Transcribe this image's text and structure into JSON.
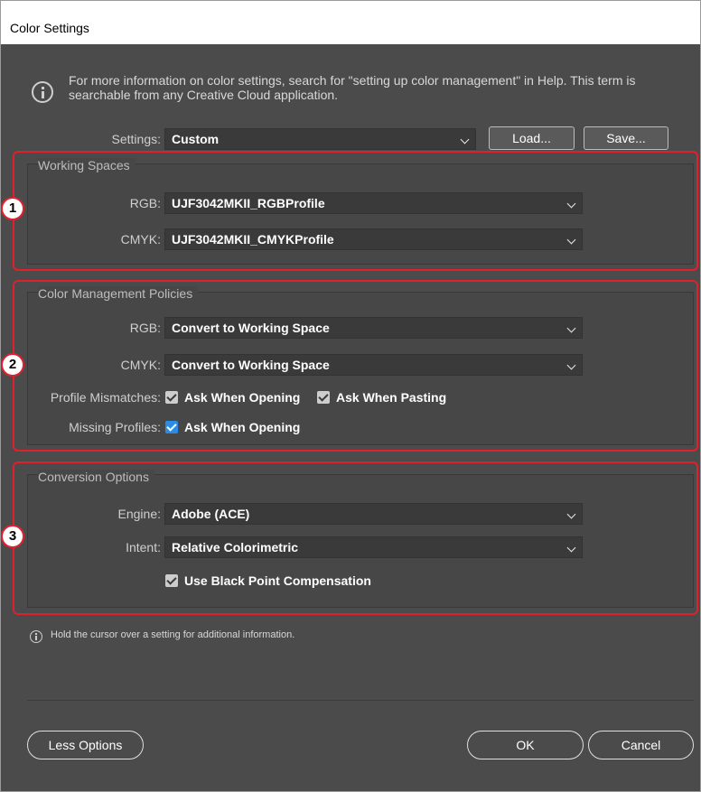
{
  "window": {
    "title": "Color Settings"
  },
  "info": {
    "text": "For more information on color settings, search for \"setting up color management\" in Help. This term is searchable from any Creative Cloud application."
  },
  "settings": {
    "label": "Settings:",
    "value": "Custom",
    "load": "Load...",
    "save": "Save..."
  },
  "working_spaces": {
    "title": "Working Spaces",
    "rgb_label": "RGB:",
    "rgb_value": "UJF3042MKII_RGBProfile",
    "cmyk_label": "CMYK:",
    "cmyk_value": "UJF3042MKII_CMYKProfile"
  },
  "policies": {
    "title": "Color Management Policies",
    "rgb_label": "RGB:",
    "rgb_value": "Convert to Working Space",
    "cmyk_label": "CMYK:",
    "cmyk_value": "Convert to Working Space",
    "mismatch_label": "Profile Mismatches:",
    "ask_opening": "Ask When Opening",
    "ask_pasting": "Ask When Pasting",
    "missing_label": "Missing Profiles:",
    "missing_ask_opening": "Ask When Opening"
  },
  "conversion": {
    "title": "Conversion Options",
    "engine_label": "Engine:",
    "engine_value": "Adobe (ACE)",
    "intent_label": "Intent:",
    "intent_value": "Relative Colorimetric",
    "bpc_label": "Use Black Point Compensation"
  },
  "hint": {
    "text": "Hold the cursor over a setting for additional information."
  },
  "buttons": {
    "less_options": "Less Options",
    "ok": "OK",
    "cancel": "Cancel"
  },
  "badges": [
    "1",
    "2",
    "3"
  ],
  "colors": {
    "highlight_red": "#e0202e",
    "checkbox_blue": "#2b8ce6",
    "dialog_bg": "#4b4b4b"
  }
}
